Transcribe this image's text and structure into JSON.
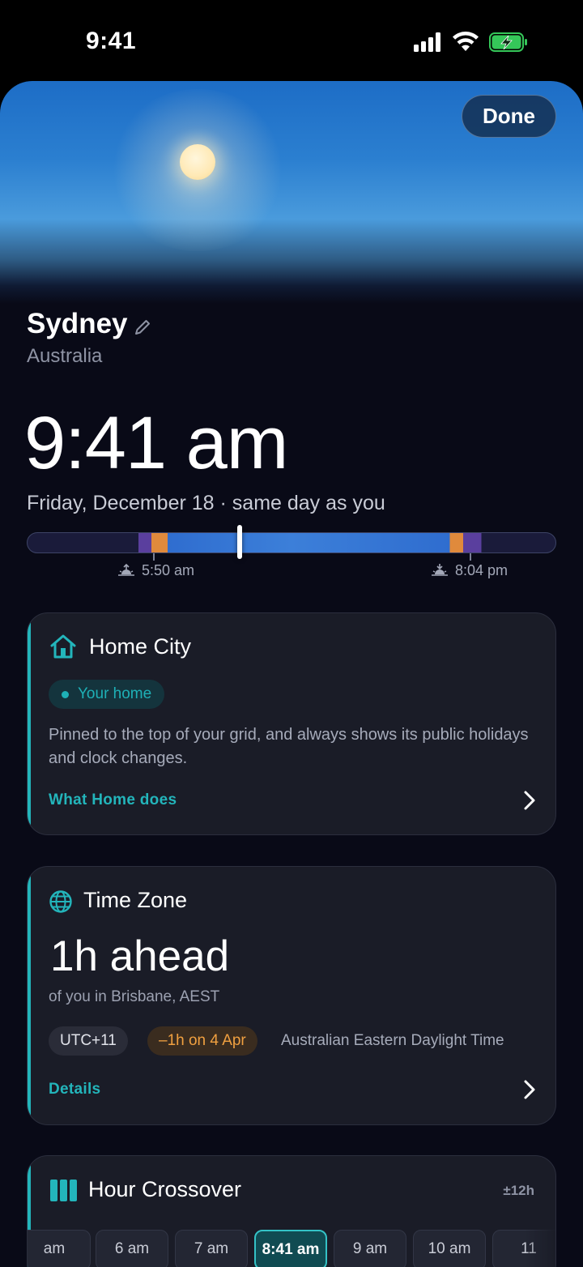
{
  "status_bar": {
    "time": "9:41"
  },
  "header": {
    "done_label": "Done"
  },
  "city": {
    "name": "Sydney",
    "country": "Australia",
    "time": "9:41 am",
    "date_line": "Friday, December 18 · same day as you",
    "sunrise": "5:50 am",
    "sunset": "8:04 pm"
  },
  "home_card": {
    "title": "Home City",
    "badge": "Your home",
    "body": "Pinned to the top of your grid, and always shows its public holidays and clock changes.",
    "link": "What Home does"
  },
  "timezone_card": {
    "title": "Time Zone",
    "headline": "1h ahead",
    "subline": "of you in Brisbane, AEST",
    "utc_chip": "UTC+11",
    "dst_chip": "–1h on 4 Apr",
    "zone_name": "Australian Eastern Daylight Time",
    "link": "Details"
  },
  "crossover_card": {
    "title": "Hour Crossover",
    "range": "±12h",
    "hours": [
      "am",
      "6 am",
      "7 am",
      "8:41 am",
      "9 am",
      "10 am",
      "11"
    ],
    "selected_index": 3
  },
  "colors": {
    "accent": "#23b5bb",
    "dst": "#f0a040",
    "background": "#090a17",
    "card": "#1a1c27"
  }
}
